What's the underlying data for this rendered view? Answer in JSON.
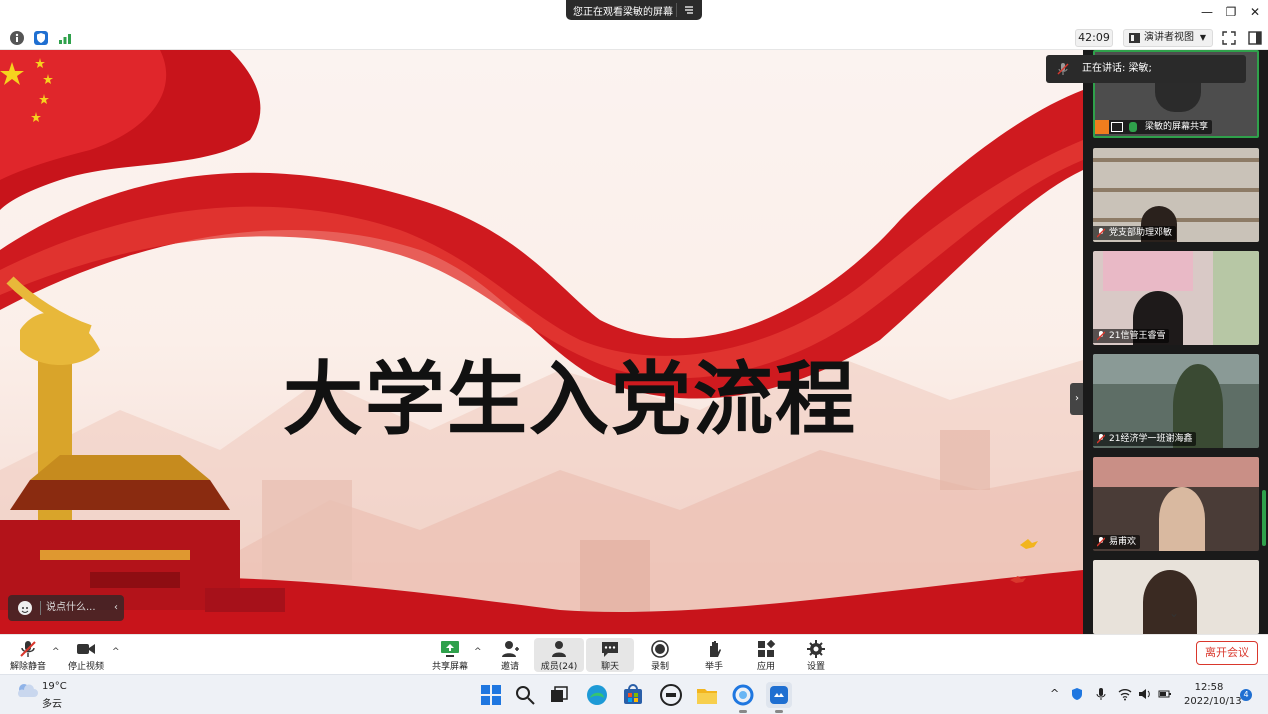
{
  "titlebar": {
    "share_banner": "您正在观看梁敏的屏幕",
    "controls": [
      "minimize",
      "restore",
      "close"
    ]
  },
  "toolbar": {
    "timer": "42:09",
    "view_label": "演讲者视图"
  },
  "slide": {
    "title": "大学生入党流程",
    "speaker_label": "正在讲话: 梁敏;",
    "chat_placeholder": "说点什么..."
  },
  "gallery": {
    "tiles": [
      {
        "name": "梁敏的屏幕共享",
        "bg": "#6b6b6b"
      },
      {
        "name": "党支部助理邓敏",
        "bg": "#c9c2b8"
      },
      {
        "name": "21信管王睿雪",
        "bg": "#d9c9c6"
      },
      {
        "name": "21经济学一班谢海鑫",
        "bg": "#5e6e66"
      },
      {
        "name": "易甫欢",
        "bg": "#4a3c37"
      },
      {
        "name": "",
        "bg": "#e8e2da"
      }
    ]
  },
  "bottombar": {
    "unmute": "解除静音",
    "stop_video": "停止视频",
    "share": "共享屏幕",
    "invite": "邀请",
    "members": "成员(24)",
    "chat": "聊天",
    "record": "录制",
    "raise_hand": "举手",
    "apps": "应用",
    "settings": "设置",
    "leave": "离开会议"
  },
  "taskbar": {
    "temperature": "19°C",
    "weather": "多云",
    "time": "12:58",
    "date": "2022/10/13",
    "notifications": "4"
  },
  "colors": {
    "accent_red": "#d9372c",
    "gallery_bg": "#1a1a1a",
    "active_speaker_border": "#2fa14b"
  }
}
